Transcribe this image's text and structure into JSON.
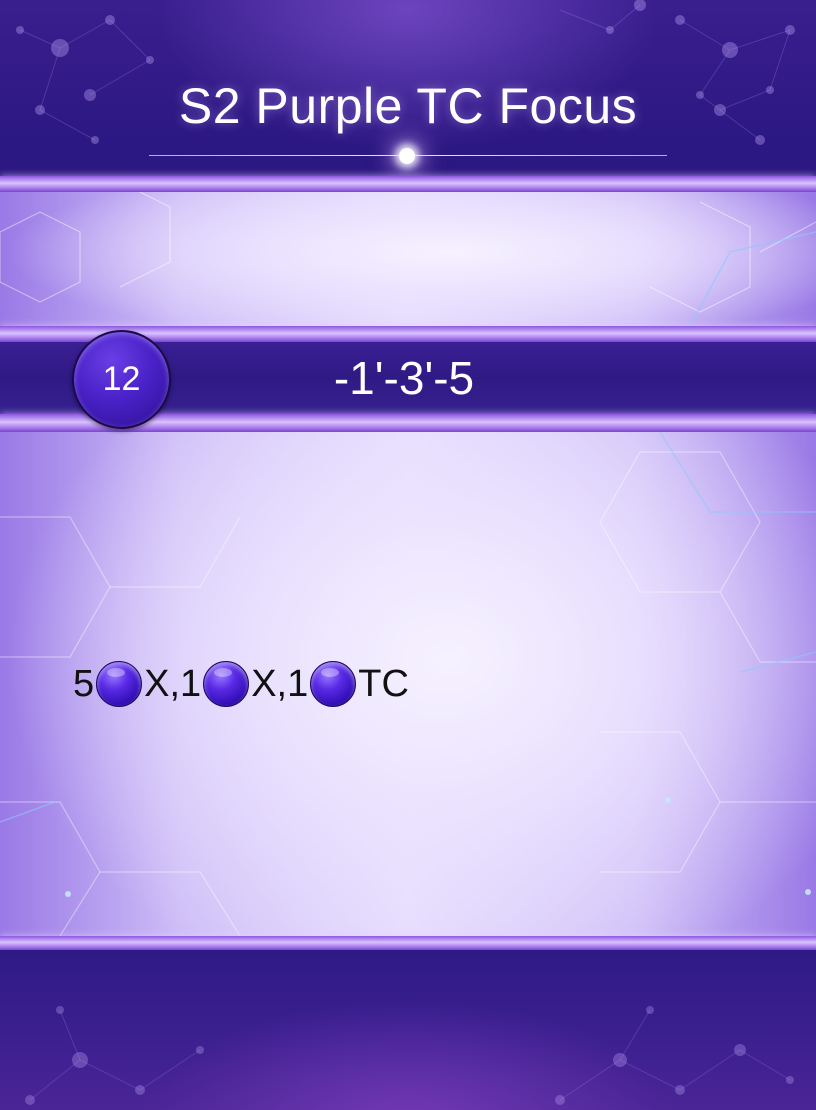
{
  "card": {
    "title": "S2 Purple TC Focus",
    "cost_badge": "12",
    "cost_sequence": "-1'-3'-5",
    "effect": [
      {
        "text": "5",
        "orb": "purple-orb-icon"
      },
      {
        "text": "X,1",
        "orb": "purple-orb-icon"
      },
      {
        "text": "X,1",
        "orb": "purple-orb-icon"
      },
      {
        "text": "TC"
      }
    ]
  },
  "colors": {
    "frame_dark": "#2f1a85",
    "accent_bar": "#d9c2ff",
    "orb": "#4a22c8",
    "text_light": "#ffffff",
    "text_dark": "#111111"
  }
}
